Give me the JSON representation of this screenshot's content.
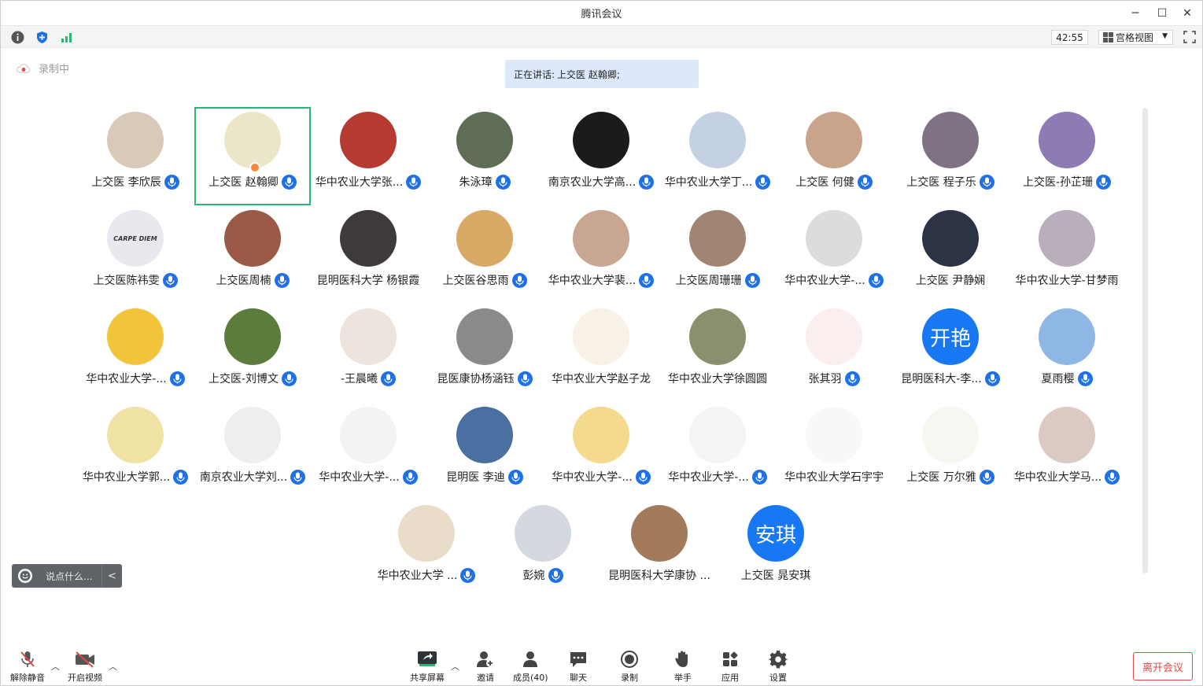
{
  "window": {
    "title": "腾讯会议",
    "min_icon": "minimize-icon",
    "max_icon": "maximize-icon",
    "close_icon": "close-icon"
  },
  "toolbar": {
    "timer": "42:55",
    "view_label": "宫格视图"
  },
  "recording_label": "录制中",
  "speaking": {
    "prefix": "正在讲话:",
    "names": "上交医 赵翰卿;"
  },
  "participants": [
    {
      "name": "上交医 李欣辰",
      "color": "#d9c9b8",
      "mic": true,
      "avatar_text": ""
    },
    {
      "name": "上交医 赵翰卿",
      "color": "#ece6c9",
      "mic": true,
      "avatar_text": "",
      "active": true
    },
    {
      "name": "华中农业大学张...",
      "color": "#b63a32",
      "mic": true,
      "avatar_text": ""
    },
    {
      "name": "朱泳璋",
      "color": "#5f6d56",
      "mic": true,
      "avatar_text": ""
    },
    {
      "name": "南京农业大学高...",
      "color": "#1d1a1a",
      "mic": true,
      "avatar_text": ""
    },
    {
      "name": "华中农业大学丁...",
      "color": "#c4d1e3",
      "mic": true,
      "avatar_text": ""
    },
    {
      "name": "上交医 何健",
      "color": "#c9a38a",
      "mic": true,
      "avatar_text": ""
    },
    {
      "name": "上交医 程子乐",
      "color": "#7f7285",
      "mic": true,
      "avatar_text": ""
    },
    {
      "name": "上交医-孙芷珊",
      "color": "#8d7bb3",
      "mic": true,
      "avatar_text": ""
    },
    {
      "name": "上交医陈祎雯",
      "color": "#e8e9ef",
      "mic": true,
      "avatar_text": "CARPE DIEM"
    },
    {
      "name": "上交医周楠",
      "color": "#9a5a45",
      "mic": true,
      "avatar_text": ""
    },
    {
      "name": "昆明医科大学 杨银霞",
      "color": "#3f3b3a",
      "mic": false,
      "avatar_text": ""
    },
    {
      "name": "上交医谷思雨",
      "color": "#d8a865",
      "mic": true,
      "avatar_text": ""
    },
    {
      "name": "华中农业大学裴...",
      "color": "#c9a692",
      "mic": true,
      "avatar_text": ""
    },
    {
      "name": "上交医周珊珊",
      "color": "#a08574",
      "mic": true,
      "avatar_text": ""
    },
    {
      "name": "华中农业大学-...",
      "color": "#dcdcdc",
      "mic": true,
      "avatar_text": ""
    },
    {
      "name": "上交医 尹静娴",
      "color": "#2c3344",
      "mic": false,
      "avatar_text": ""
    },
    {
      "name": "华中农业大学-甘梦雨",
      "color": "#b9aebc",
      "mic": false,
      "avatar_text": ""
    },
    {
      "name": "华中农业大学-...",
      "color": "#f2c43a",
      "mic": true,
      "avatar_text": ""
    },
    {
      "name": "上交医-刘博文",
      "color": "#5c7c3e",
      "mic": true,
      "avatar_text": ""
    },
    {
      "name": "-王晨曦",
      "color": "#ece4dd",
      "mic": true,
      "avatar_text": ""
    },
    {
      "name": "昆医康协杨涵钰",
      "color": "#8a8a8a",
      "mic": true,
      "avatar_text": ""
    },
    {
      "name": "华中农业大学赵子龙",
      "color": "#f8f2e6",
      "mic": false,
      "avatar_text": ""
    },
    {
      "name": "华中农业大学徐圆圆",
      "color": "#8b8f6e",
      "mic": false,
      "avatar_text": ""
    },
    {
      "name": "张其羽",
      "color": "#fbeeee",
      "mic": true,
      "avatar_text": ""
    },
    {
      "name": "昆明医科大-李...",
      "color": "#1877f2",
      "mic": true,
      "avatar_text": "开艳"
    },
    {
      "name": "夏雨樱",
      "color": "#8fb7e6",
      "mic": true,
      "avatar_text": ""
    },
    {
      "name": "华中农业大学郭...",
      "color": "#efe2a4",
      "mic": true,
      "avatar_text": ""
    },
    {
      "name": "南京农业大学刘...",
      "color": "#eeeeee",
      "mic": true,
      "avatar_text": ""
    },
    {
      "name": "华中农业大学-...",
      "color": "#f3f3f3",
      "mic": true,
      "avatar_text": ""
    },
    {
      "name": "昆明医 李迪",
      "color": "#4a6fa0",
      "mic": true,
      "avatar_text": ""
    },
    {
      "name": "华中农业大学-...",
      "color": "#f5d98c",
      "mic": true,
      "avatar_text": ""
    },
    {
      "name": "华中农业大学-...",
      "color": "#f4f4f4",
      "mic": true,
      "avatar_text": ""
    },
    {
      "name": "华中农业大学石宇宇",
      "color": "#f8f8f8",
      "mic": false,
      "avatar_text": ""
    },
    {
      "name": "上交医 万尔雅",
      "color": "#f7f7f2",
      "mic": true,
      "avatar_text": ""
    },
    {
      "name": "华中农业大学马...",
      "color": "#dcc9c4",
      "mic": true,
      "avatar_text": ""
    },
    {
      "name": "华中农业大学 ...",
      "color": "#e9dcc8",
      "mic": true,
      "avatar_text": ""
    },
    {
      "name": "彭婉",
      "color": "#d4d8df",
      "mic": true,
      "avatar_text": ""
    },
    {
      "name": "昆明医科大学康协 ...",
      "color": "#a47a5c",
      "mic": false,
      "avatar_text": ""
    },
    {
      "name": "上交医 晁安琪",
      "color": "#1877f2",
      "mic": false,
      "avatar_text": "安琪"
    }
  ],
  "chat": {
    "placeholder": "说点什么...",
    "emoji_icon": "smile-icon",
    "collapse_icon": "chevron-left-icon"
  },
  "bottom": {
    "unmute": "解除静音",
    "video": "开启视频",
    "share": "共享屏幕",
    "invite": "邀请",
    "members": "成员(40)",
    "chat": "聊天",
    "record": "录制",
    "raise_hand": "举手",
    "apps": "应用",
    "settings": "设置",
    "leave": "离开会议"
  },
  "colors": {
    "accent": "#1e6fe8",
    "active_border": "#2bb673",
    "leave": "#e24a4a",
    "banner": "#dde9fb"
  }
}
